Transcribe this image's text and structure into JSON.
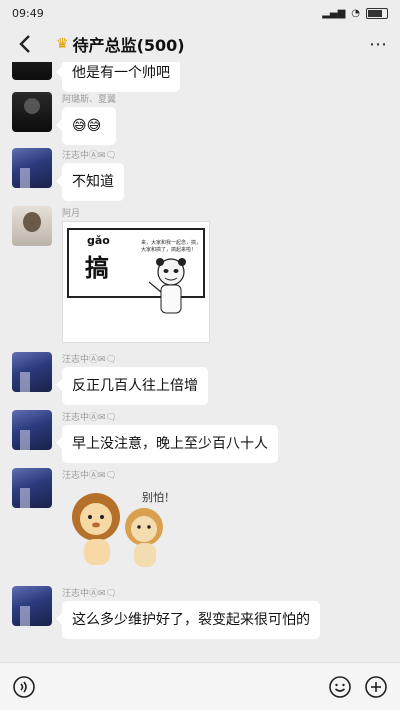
{
  "status": {
    "time": "09:49",
    "network": "5G 5G",
    "battery": "battery"
  },
  "header": {
    "title": "待产总监(500)"
  },
  "messages": [
    {
      "sender": "",
      "text": "他是有一个帅吧"
    },
    {
      "sender": "阿璐斯、夏翼",
      "text": "😅😅"
    },
    {
      "sender": "汪志中Ⓐ✉🗨",
      "text": "不知道"
    },
    {
      "sender": "阿月",
      "sticker": {
        "pinyin": "gǎo",
        "hanzi": "搞",
        "note": "来，大家和我一起念，搞，大家和搞了，搞起来啦！"
      }
    },
    {
      "sender": "汪志中Ⓐ✉🗨",
      "text": "反正几百人往上倍增"
    },
    {
      "sender": "汪志中Ⓐ✉🗨",
      "text": "早上没注意，晚上至少百八十人"
    },
    {
      "sender": "汪志中Ⓐ✉🗨",
      "sticker2": {
        "caption": "别怕！"
      }
    },
    {
      "sender": "汪志中Ⓐ✉🗨",
      "text": "这么多少维护好了，裂变起来很可怕的"
    }
  ],
  "icons": {
    "back": "chevron-left-icon",
    "more": "more-icon",
    "voice": "voice-icon",
    "emoji": "emoji-icon",
    "plus": "plus-icon"
  }
}
